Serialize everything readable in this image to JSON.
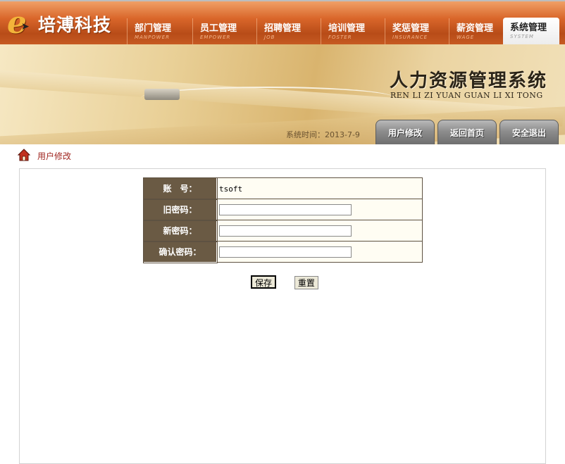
{
  "header": {
    "logo_letter": "e",
    "logo_text": "培溥科技",
    "nav": [
      {
        "label": "部门管理",
        "sub": "MANPOWER"
      },
      {
        "label": "员工管理",
        "sub": "EMPOWER"
      },
      {
        "label": "招聘管理",
        "sub": "JOB"
      },
      {
        "label": "培训管理",
        "sub": "FOSTER"
      },
      {
        "label": "奖惩管理",
        "sub": "INSURANCE"
      },
      {
        "label": "薪资管理",
        "sub": "WAGE"
      },
      {
        "label": "系统管理",
        "sub": "SYSTEM"
      }
    ],
    "active_nav": "系统管理"
  },
  "banner": {
    "title_cn": "人力资源管理系统",
    "title_en": "REN LI ZI YUAN GUAN LI XI TONG",
    "system_time_label": "系统时间：",
    "system_time_value": "2013-7-9",
    "buttons": [
      "用户修改",
      "返回首页",
      "安全退出"
    ]
  },
  "breadcrumb": {
    "icon": "home-icon",
    "label": "用户修改"
  },
  "form": {
    "account_label": "账　号：",
    "account_value": "tsoft",
    "old_password_label": "旧密码：",
    "old_password_value": "",
    "new_password_label": "新密码：",
    "new_password_value": "",
    "confirm_password_label": "确认密码：",
    "confirm_password_value": "",
    "save_label": "保存",
    "reset_label": "重置"
  },
  "colors": {
    "nav_orange": "#c65a22",
    "label_cell": "#6a5a44",
    "crumb_red": "#a02620"
  }
}
